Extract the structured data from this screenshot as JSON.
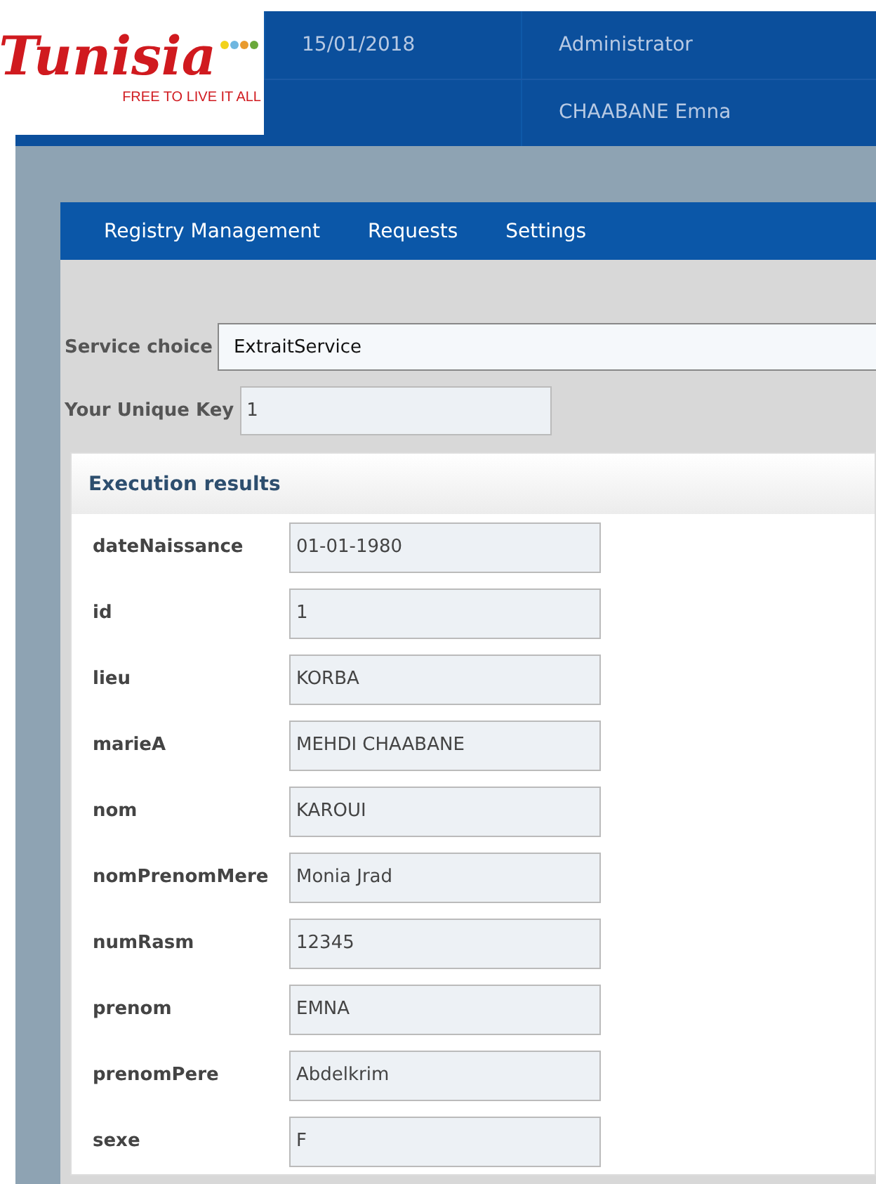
{
  "logo": {
    "wordmark": "Tunisia",
    "tagline": "FREE TO LIVE IT ALL"
  },
  "header": {
    "date": "15/01/2018",
    "role": "Administrator",
    "user": "CHAABANE Emna"
  },
  "nav": [
    {
      "label": "Registry Management"
    },
    {
      "label": "Requests"
    },
    {
      "label": "Settings"
    }
  ],
  "form": {
    "service_label": "Service choice",
    "service_value": "ExtraitService",
    "key_label": "Your Unique Key",
    "key_value": "1"
  },
  "results": {
    "title": "Execution results",
    "fields": [
      {
        "label": "dateNaissance",
        "value": "01-01-1980"
      },
      {
        "label": "id",
        "value": "1"
      },
      {
        "label": "lieu",
        "value": "KORBA"
      },
      {
        "label": "marieA",
        "value": "MEHDI CHAABANE"
      },
      {
        "label": "nom",
        "value": "KAROUI"
      },
      {
        "label": "nomPrenomMere",
        "value": "Monia Jrad"
      },
      {
        "label": "numRasm",
        "value": "12345"
      },
      {
        "label": "prenom",
        "value": "EMNA"
      },
      {
        "label": "prenomPere",
        "value": "Abdelkrim"
      },
      {
        "label": "sexe",
        "value": "F"
      }
    ]
  }
}
